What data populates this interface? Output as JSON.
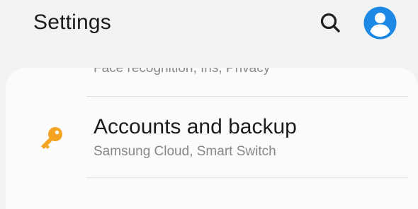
{
  "header": {
    "title": "Settings",
    "search_icon": "search-icon",
    "avatar_icon": "account-avatar-icon"
  },
  "list": {
    "previous_item_subtitle": "Face recognition, Iris, Privacy",
    "items": [
      {
        "icon": "key-icon",
        "title": "Accounts and backup",
        "subtitle": "Samsung Cloud, Smart Switch"
      }
    ]
  },
  "colors": {
    "page_background": "#f2f2f2",
    "card_background": "#fbfbfb",
    "accent_blue": "#1e88e5",
    "key_icon_orange": "#f5a323",
    "primary_text": "#1b1b1b",
    "secondary_text": "#878787"
  }
}
